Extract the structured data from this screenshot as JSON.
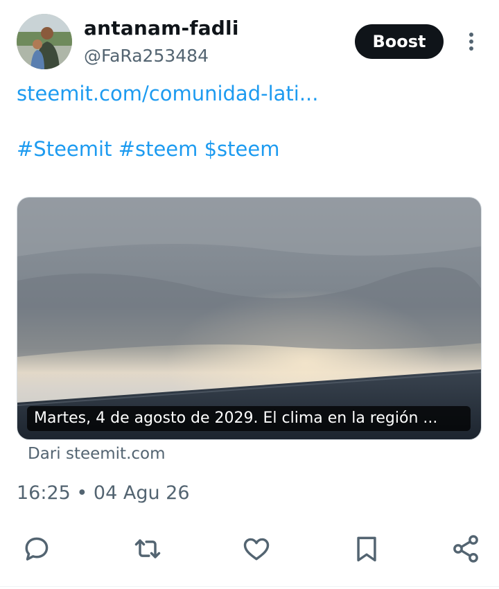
{
  "author": {
    "display_name": "antanam-fadli",
    "handle": "@FaRa253484",
    "avatar_icon": "user-avatar-photo"
  },
  "boost_label": "Boost",
  "post": {
    "link_text": "steemit.com/comunidad-lati...",
    "hashtags": [
      "#Steemit",
      "#steem",
      "$steem"
    ]
  },
  "card": {
    "caption": "Martes, 4 de agosto de 2029. El clima en la región ...",
    "source": "Dari steemit.com"
  },
  "meta": {
    "time": "16:25",
    "separator": " • ",
    "date": "04 Agu 26"
  },
  "actions": [
    {
      "name": "reply",
      "icon": "reply-icon"
    },
    {
      "name": "repost",
      "icon": "repost-icon"
    },
    {
      "name": "like",
      "icon": "heart-icon"
    },
    {
      "name": "bookmark",
      "icon": "bookmark-icon"
    },
    {
      "name": "share",
      "icon": "share-icon"
    }
  ],
  "colors": {
    "link": "#1d9bf0",
    "text_primary": "#0f1419",
    "text_secondary": "#536471",
    "icon": "#536471"
  }
}
